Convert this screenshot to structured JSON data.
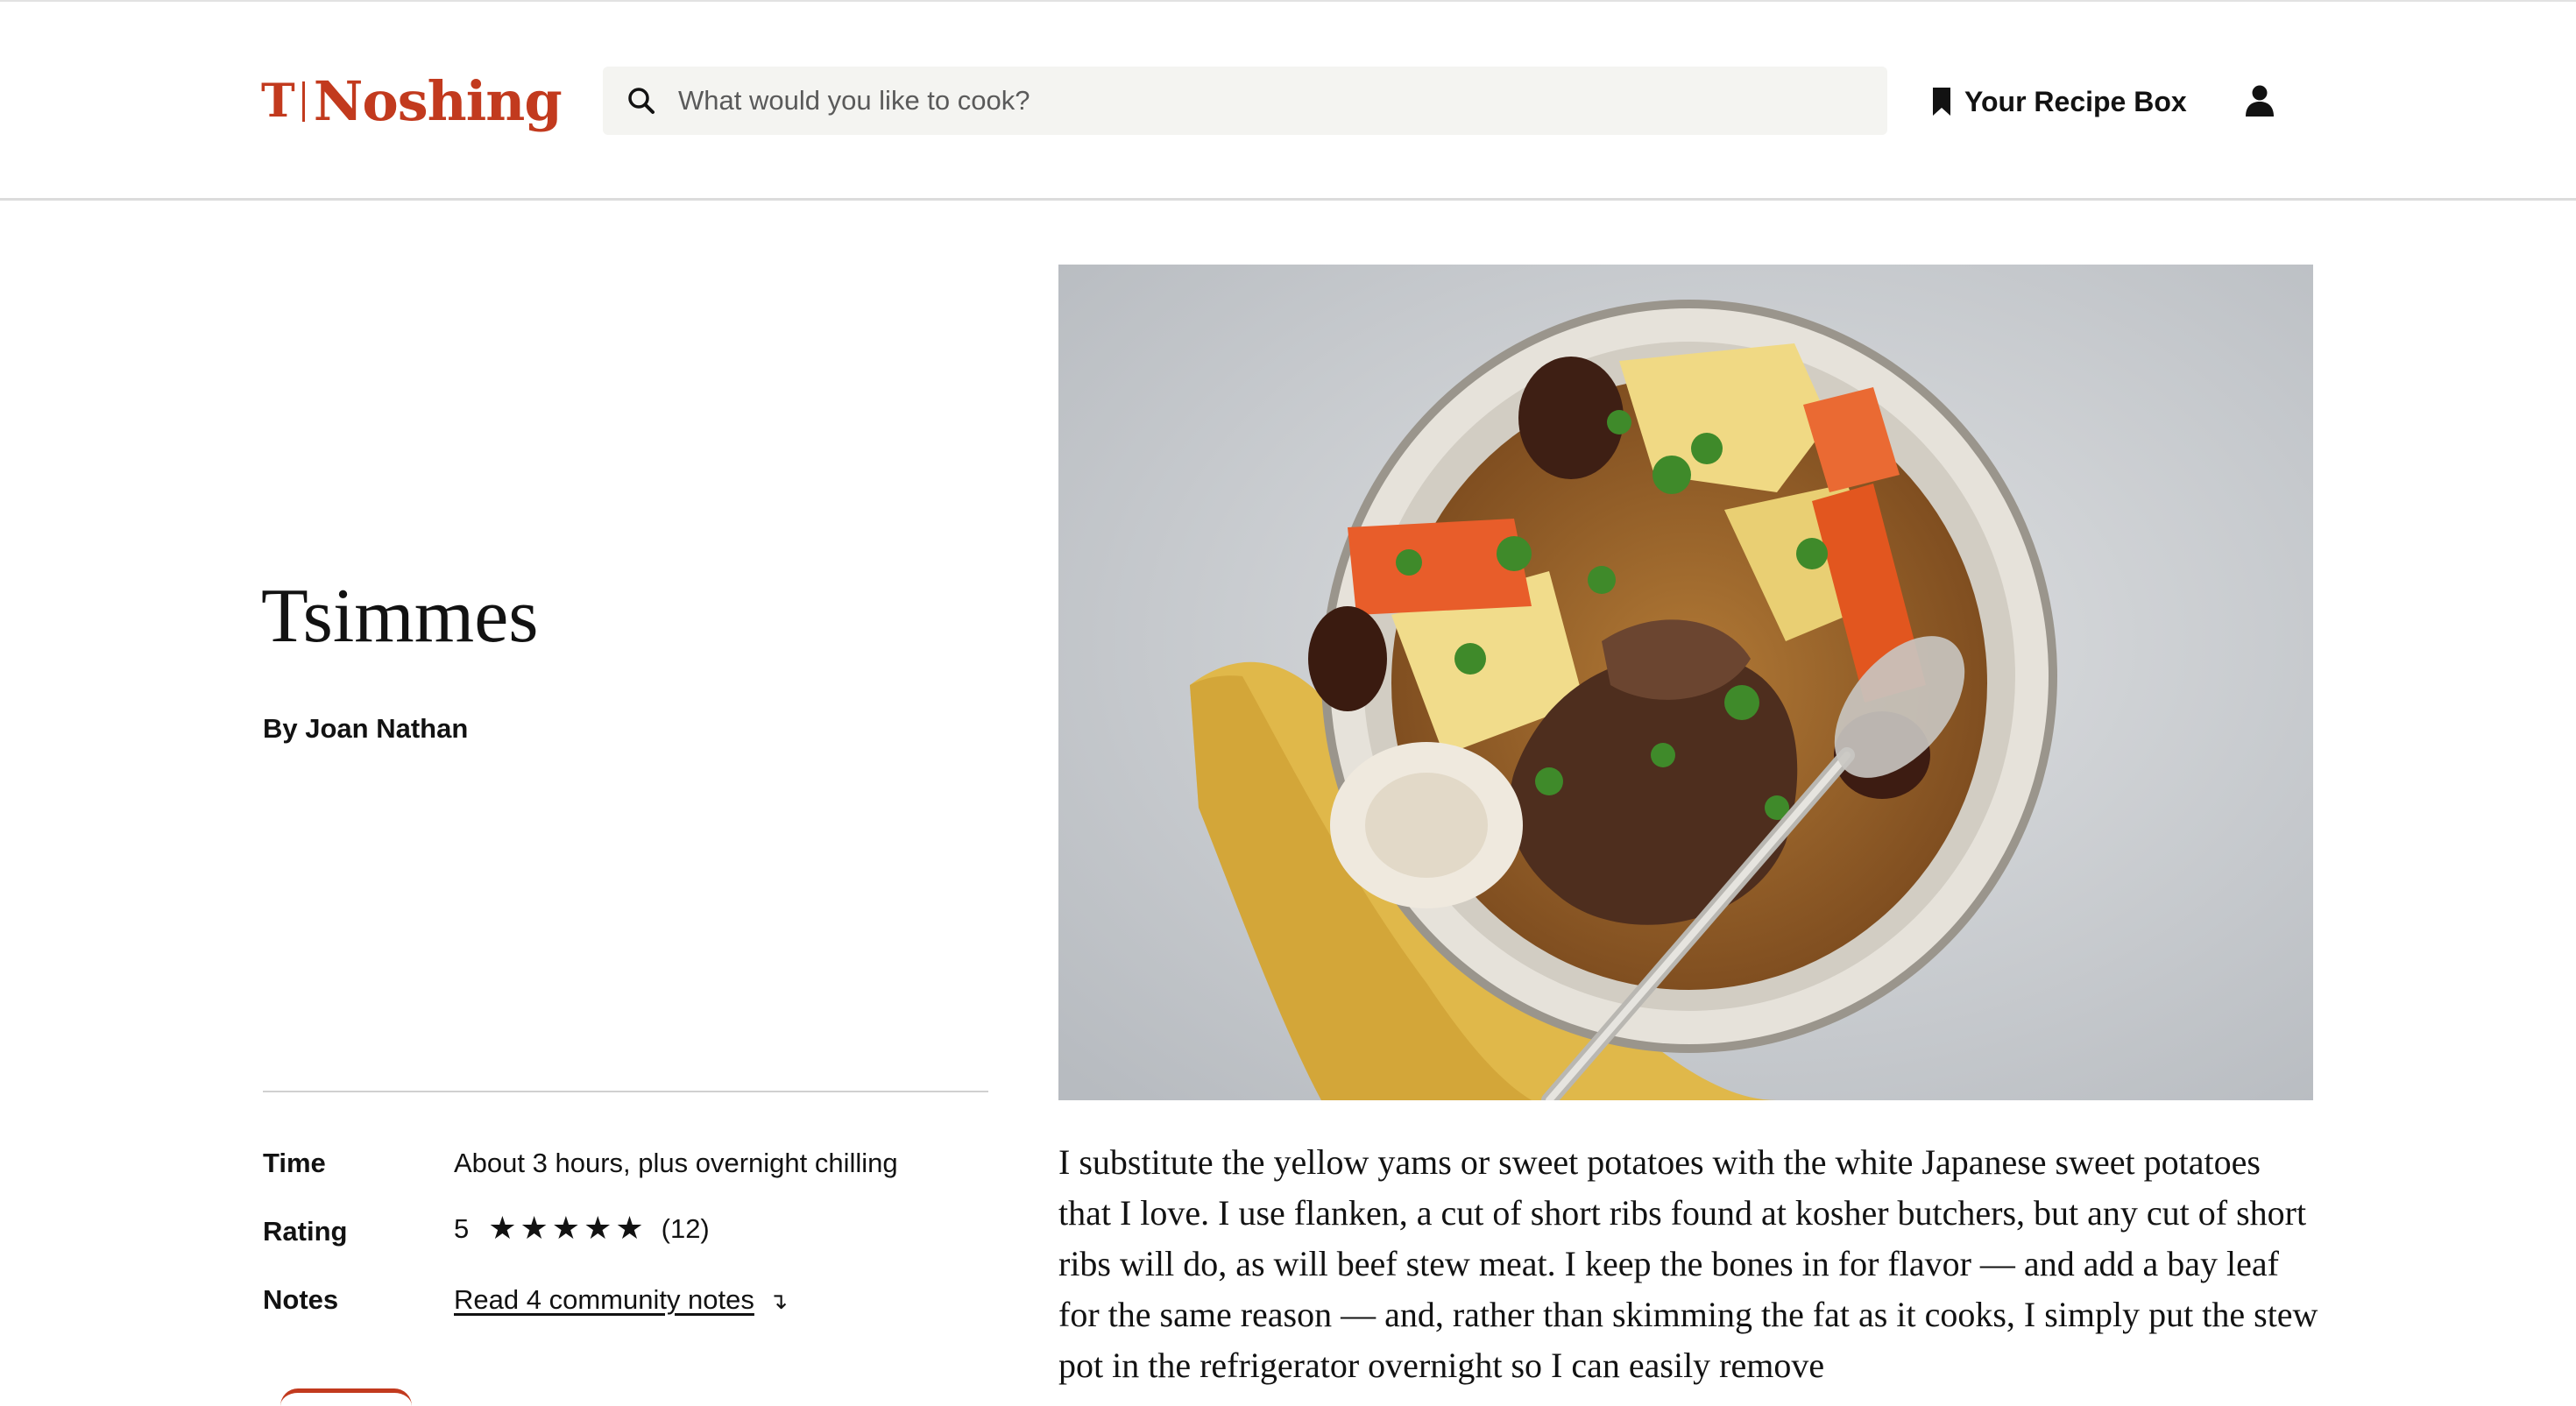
{
  "brand": {
    "logo_letter": "T",
    "name": "Noshing"
  },
  "search": {
    "placeholder": "What would you like to cook?"
  },
  "header": {
    "recipe_box_label": "Your Recipe Box"
  },
  "recipe": {
    "title": "Tsimmes",
    "byline": "By Joan Nathan",
    "time_label": "Time",
    "time_value": "About 3 hours, plus overnight chilling",
    "rating_label": "Rating",
    "rating_value": "5",
    "rating_stars": "★★★★★",
    "rating_count": "(12)",
    "notes_label": "Notes",
    "notes_link": "Read 4 community notes",
    "notes_arrow": "↴",
    "description": "I substitute the yellow yams or sweet potatoes with the white Japanese sweet potatoes that I love. I use flanken, a cut of short ribs found at kosher butchers, but any cut of short ribs will do, as will beef stew meat. I keep the bones in for flavor — and add a bay leaf for the same reason — and, rather than skimming the fat as it cooks, I simply put the stew pot in the refrigerator overnight so I can easily remove"
  },
  "colors": {
    "brand": "#c23a1e",
    "search_bg": "#f4f4f1",
    "divider": "#d0d0d0"
  },
  "icons": {
    "search": "search-icon",
    "bookmark": "bookmark-icon",
    "account": "account-icon"
  }
}
